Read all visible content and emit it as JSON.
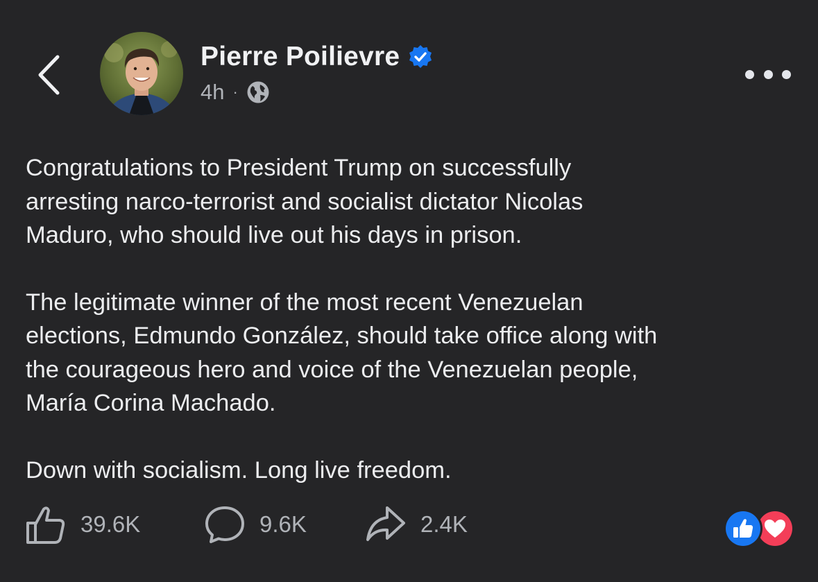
{
  "header": {
    "author_name": "Pierre Poilievre",
    "time": "4h",
    "separator": "·",
    "icons": {
      "back": "chevron-left-icon",
      "verified": "verified-badge-icon",
      "audience": "globe-icon",
      "more": "more-horizontal-icon"
    }
  },
  "post": {
    "paragraphs": [
      "Congratulations to President Trump on successfully\narresting narco-terrorist and socialist dictator Nicolas\nMaduro, who should live out his days in prison.",
      "The legitimate winner of the most recent Venezuelan\nelections, Edmundo González, should take office along with\nthe courageous hero and voice of the Venezuelan people,\nMaría Corina Machado.",
      "Down with socialism. Long live freedom."
    ]
  },
  "actions": {
    "likes": "39.6K",
    "comments": "9.6K",
    "shares": "2.4K",
    "icons": {
      "like": "thumbs-up-icon",
      "comment": "comment-bubble-icon",
      "share": "share-arrow-icon"
    }
  },
  "reactions": [
    {
      "type": "like",
      "icon": "like-reaction-icon",
      "color": "#1877f2"
    },
    {
      "type": "love",
      "icon": "heart-reaction-icon",
      "color": "#f33e58"
    }
  ],
  "colors": {
    "background": "#252527",
    "verified": "#1877f2",
    "secondary_text": "#b0b3b8"
  }
}
